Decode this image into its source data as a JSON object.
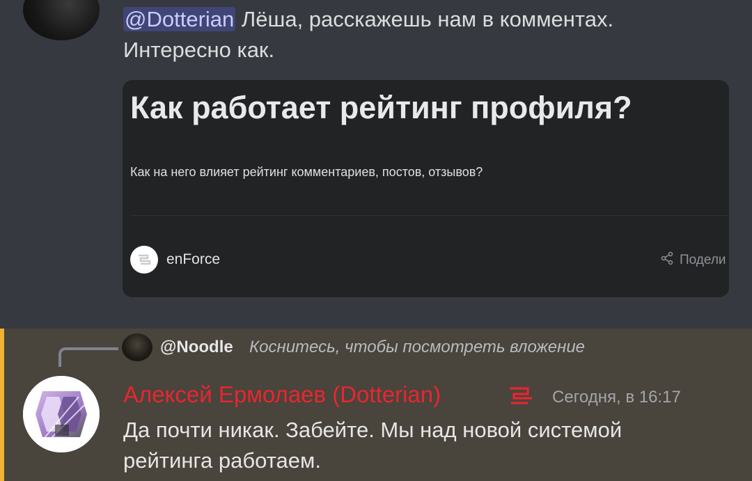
{
  "message_top": {
    "mention": "@Dotterian",
    "text_line1": " Лёша, расскажешь нам в комментах.",
    "text_line2": "Интересно как."
  },
  "embed": {
    "title": "Как работает рейтинг профиля?",
    "description": "Как на него влияет рейтинг комментариев, постов, отзывов?",
    "brand": "enForce",
    "share_label": "Подели"
  },
  "reply": {
    "name": "@Noodle",
    "text": "Коснитесь, чтобы посмотреть вложение"
  },
  "message_bottom": {
    "author": "Алексей Ермолаев (Dotterian)",
    "timestamp": "Сегодня, в 16:17",
    "text_line1": "Да почти никак. Забейте. Мы над новой системой",
    "text_line2": "рейтинга работаем."
  },
  "colors": {
    "accent": "#f0b232",
    "author": "#e8262f",
    "mention_bg": "#5865f2"
  }
}
